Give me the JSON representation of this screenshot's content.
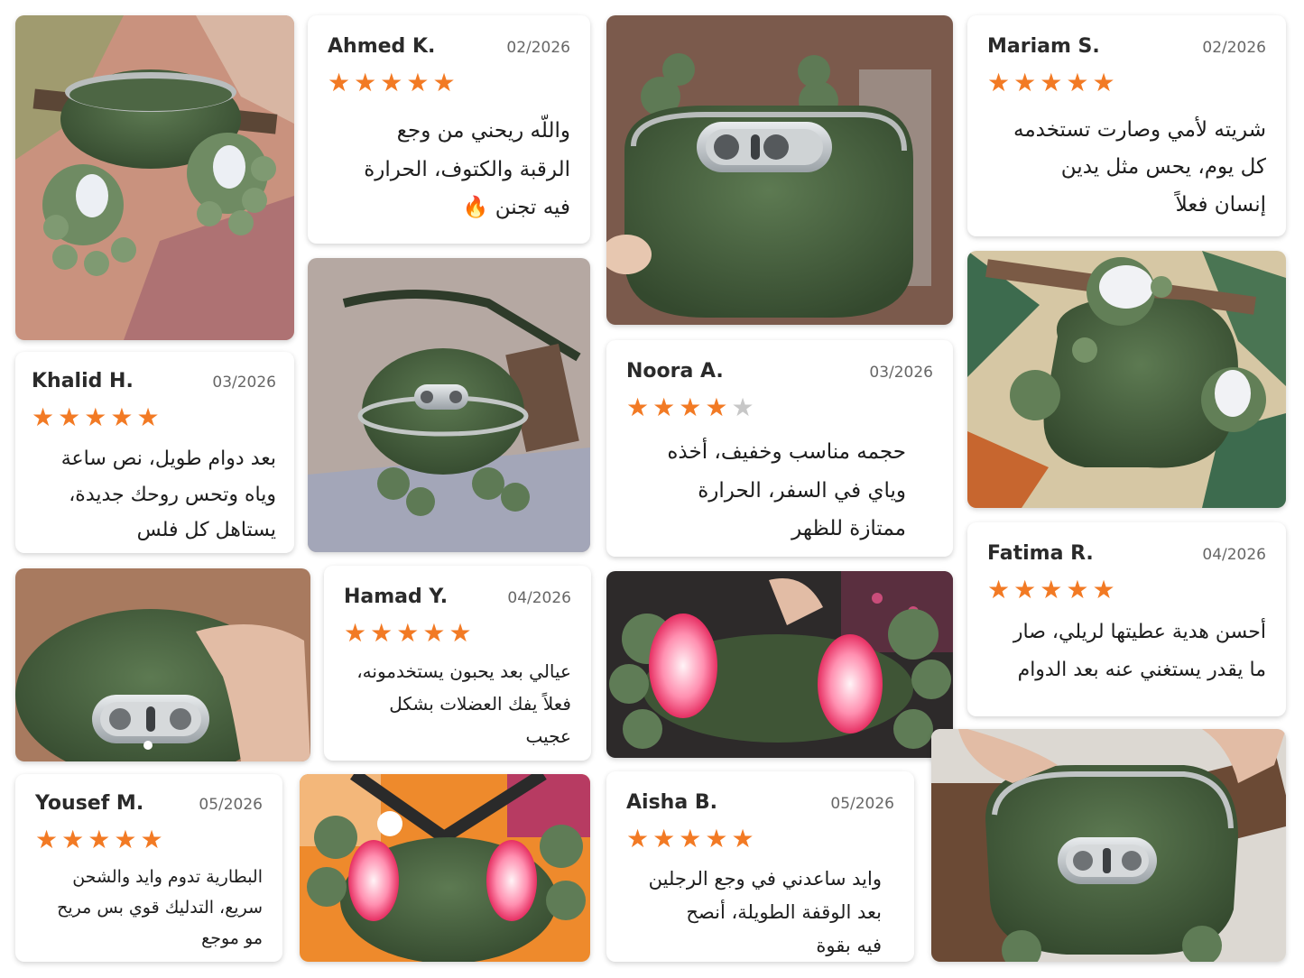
{
  "colors": {
    "star_active": "#f27a24",
    "star_inactive": "#c7c7c7",
    "device_green": "#4a6440"
  },
  "reviews": [
    {
      "name": "Ahmed K.",
      "date": "02/2026",
      "rating": 5,
      "text": "واللّه ريحني من وجع\nالرقبة والكتوف، الحرارة\nفيه تجنن 🔥"
    },
    {
      "name": "Mariam S.",
      "date": "02/2026",
      "rating": 5,
      "text": "شريته لأمي وصارت تستخدمه\nكل يوم، يحس مثل يدين\nإنسان فعلاً"
    },
    {
      "name": "Khalid H.",
      "date": "03/2026",
      "rating": 5,
      "text": "بعد دوام طويل، نص ساعة\nوياه وتحس روحك جديدة،\nيستاهل كل فلس"
    },
    {
      "name": "Noora A.",
      "date": "03/2026",
      "rating": 4,
      "text": "حجمه مناسب وخفيف، أخذه\nوياي في السفر، الحرارة\nممتازة للظهر"
    },
    {
      "name": "Fatima R.",
      "date": "04/2026",
      "rating": 5,
      "text": "أحسن هدية عطيتها لريلي، صار\nما يقدر يستغني عنه بعد الدوام"
    },
    {
      "name": "Hamad Y.",
      "date": "04/2026",
      "rating": 5,
      "text": "عيالي بعد يحبون يستخدمونه،\nفعلاً يفك العضلات بشكل\nعجيب"
    },
    {
      "name": "Yousef M.",
      "date": "05/2026",
      "rating": 5,
      "text": "البطارية تدوم وايد والشحن\nسريع، التدليك قوي بس مريح\nمو موجع"
    },
    {
      "name": "Aisha B.",
      "date": "05/2026",
      "rating": 5,
      "text": "وايد ساعدني في وجع الرجلين\nبعد الوقفة الطويلة، أنصح\nفيه بقوة"
    }
  ]
}
